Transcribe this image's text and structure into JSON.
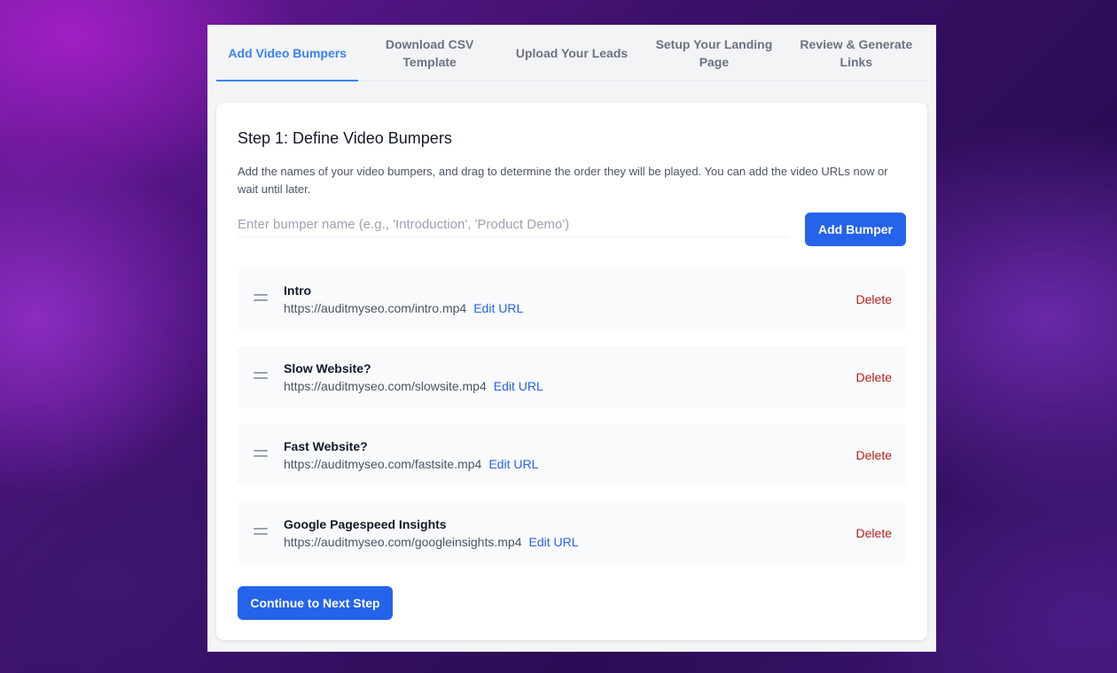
{
  "tabs": [
    {
      "label": "Add Video Bumpers",
      "active": true
    },
    {
      "label": "Download CSV Template",
      "active": false
    },
    {
      "label": "Upload Your Leads",
      "active": false
    },
    {
      "label": "Setup Your Landing Page",
      "active": false
    },
    {
      "label": "Review & Generate Links",
      "active": false
    }
  ],
  "step": {
    "title": "Step 1: Define Video Bumpers",
    "description": "Add the names of your video bumpers, and drag to determine the order they will be played. You can add the video URLs now or wait until later.",
    "input_placeholder": "Enter bumper name (e.g., 'Introduction', 'Product Demo')",
    "input_value": "",
    "add_button_label": "Add Bumper",
    "continue_button_label": "Continue to Next Step"
  },
  "bumpers": [
    {
      "name": "Intro",
      "url": "https://auditmyseo.com/intro.mp4",
      "edit_label": "Edit URL",
      "delete_label": "Delete"
    },
    {
      "name": "Slow Website?",
      "url": "https://auditmyseo.com/slowsite.mp4",
      "edit_label": "Edit URL",
      "delete_label": "Delete"
    },
    {
      "name": "Fast Website?",
      "url": "https://auditmyseo.com/fastsite.mp4",
      "edit_label": "Edit URL",
      "delete_label": "Delete"
    },
    {
      "name": "Google Pagespeed Insights",
      "url": "https://auditmyseo.com/googleinsights.mp4",
      "edit_label": "Edit URL",
      "delete_label": "Delete"
    }
  ],
  "icons": {
    "drag_handle": "drag-handle-icon"
  },
  "colors": {
    "accent": "#2563eb",
    "tab_active": "#3b82f6",
    "delete": "#b91c1c"
  }
}
